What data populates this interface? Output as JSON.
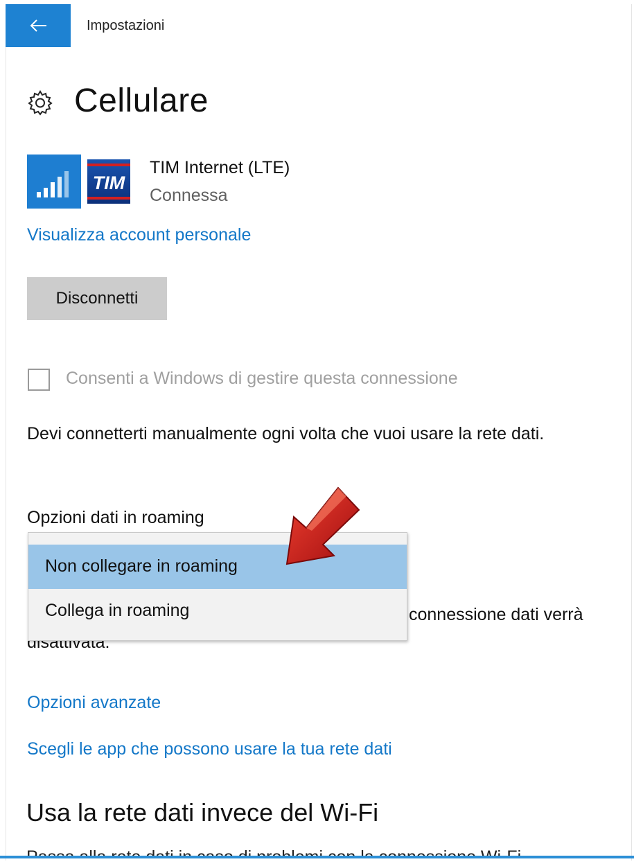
{
  "header": {
    "title": "Impostazioni"
  },
  "page": {
    "title": "Cellulare"
  },
  "network": {
    "name": "TIM Internet (LTE)",
    "status": "Connessa",
    "logo_text": "TIM"
  },
  "links": {
    "view_account": "Visualizza account personale",
    "advanced": "Opzioni avanzate",
    "choose_apps": "Scegli le app che possono usare la tua rete dati"
  },
  "buttons": {
    "disconnect": "Disconnetti"
  },
  "checkbox": {
    "label": "Consenti a Windows di gestire questa connessione",
    "checked": false
  },
  "description": "Devi connetterti manualmente ogni volta che vuoi usare la rete dati.",
  "roaming": {
    "label": "Opzioni dati in roaming",
    "options": [
      "Non collegare in roaming",
      "Collega in roaming"
    ],
    "selected": "Non collegare in roaming",
    "note_partial_1": "connessione dati verrà",
    "note_partial_2": "disattivata."
  },
  "wifi_section": {
    "title": "Usa la rete dati invece del Wi-Fi",
    "description": "Passa alla rete dati in caso di problemi con la connessione Wi-Fi."
  },
  "colors": {
    "accent": "#1e82d2",
    "link": "#1478c8",
    "selected_option": "#99c5e8",
    "arrow": "#c8181a"
  },
  "icons": {
    "back": "arrow-left-icon",
    "settings": "gear-icon",
    "signal": "signal-bars-icon",
    "annotation": "red-arrow-icon"
  }
}
